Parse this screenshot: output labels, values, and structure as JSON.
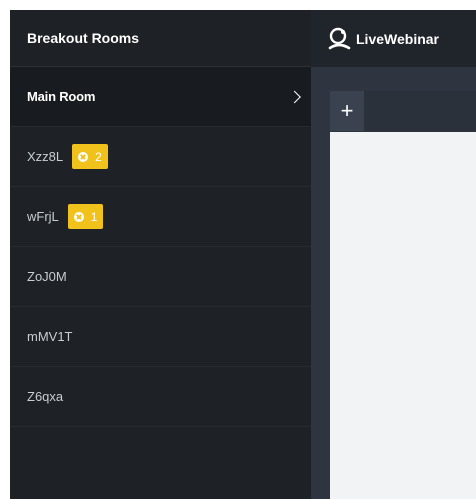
{
  "sidebar": {
    "title": "Breakout Rooms",
    "main_room": "Main Room",
    "rooms": [
      {
        "name": "Xzz8L",
        "count": "2"
      },
      {
        "name": "wFrjL",
        "count": "1"
      },
      {
        "name": "ZoJ0M",
        "count": null
      },
      {
        "name": "mMV1T",
        "count": null
      },
      {
        "name": "Z6qxa",
        "count": null
      }
    ]
  },
  "topbar": {
    "brand": "LiveWebinar"
  },
  "tabs": {
    "add_label": "+"
  },
  "colors": {
    "badge": "#f1c21b",
    "sidebar_bg": "#1e2226",
    "canvas_bg": "#f2f3f5"
  }
}
